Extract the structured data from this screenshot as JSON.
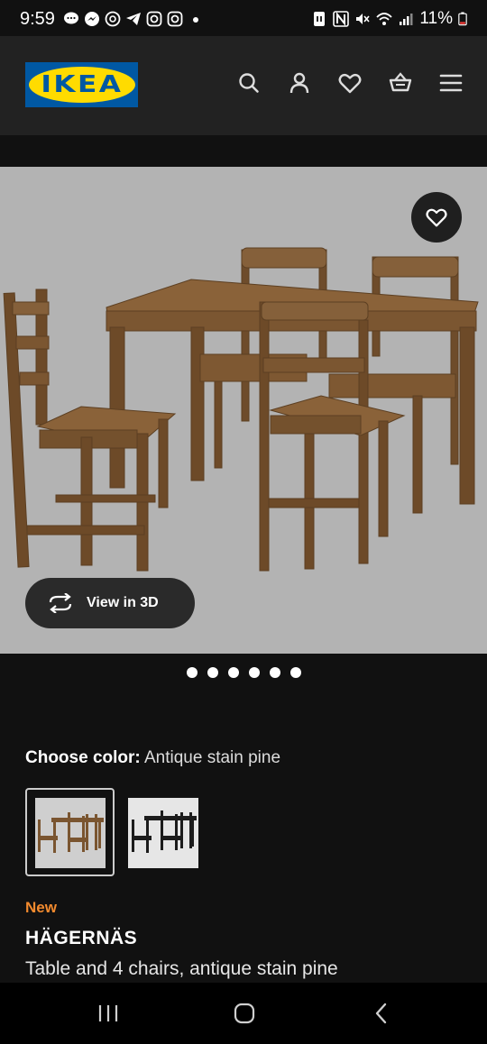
{
  "status_bar": {
    "time": "9:59",
    "battery": "11%",
    "left_icons": [
      "chat-icon",
      "messenger-icon",
      "threads-icon",
      "telegram-icon",
      "instagram-icon",
      "instagram-icon",
      "dot-icon"
    ],
    "right_icons": [
      "nfc-icon",
      "n-icon",
      "mute-icon",
      "wifi-icon",
      "signal-icon",
      "battery-icon"
    ]
  },
  "header": {
    "logo_text": "IKEA",
    "icons": [
      "search-icon",
      "account-icon",
      "heart-icon",
      "basket-icon",
      "menu-icon"
    ],
    "colors": {
      "logo_blue": "#0058a3",
      "logo_yellow": "#ffdb00"
    }
  },
  "gallery": {
    "view_3d_label": "View in 3D",
    "dot_count": 6,
    "background": "#b3b3b3"
  },
  "color_choice": {
    "label": "Choose color:",
    "value": "Antique stain pine",
    "options": [
      "antique-stain-pine",
      "black"
    ]
  },
  "product": {
    "badge": "New",
    "name": "HÄGERNÄS",
    "description": "Table and 4 chairs, antique stain pine"
  },
  "nav": {
    "buttons": [
      "recents-button",
      "home-button",
      "back-button"
    ]
  }
}
